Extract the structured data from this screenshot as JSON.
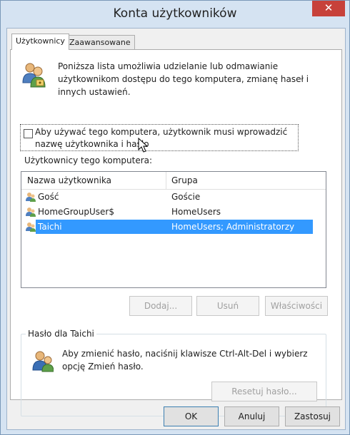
{
  "window": {
    "title": "Konta użytkowników",
    "close_glyph": "✕"
  },
  "tabs": [
    {
      "label": "Użytkownicy",
      "active": true
    },
    {
      "label": "Zaawansowane",
      "active": false
    }
  ],
  "intro": {
    "icon": "users-icon",
    "text": "Poniższa lista umożliwia udzielanie lub odmawianie użytkownikom dostępu do tego komputera, zmianę haseł i innych ustawień."
  },
  "require_password": {
    "label": "Aby używać tego komputera, użytkownik musi wprowadzić nazwę użytkownika i hasło",
    "checked": false
  },
  "users_list": {
    "heading": "Użytkownicy tego komputera:",
    "columns": {
      "name": "Nazwa użytkownika",
      "group": "Grupa"
    },
    "rows": [
      {
        "name": "Gość",
        "group": "Goście",
        "selected": false
      },
      {
        "name": "HomeGroupUser$",
        "group": "HomeUsers",
        "selected": false
      },
      {
        "name": "Taichi",
        "group": "HomeUsers; Administratorzy",
        "selected": true
      }
    ]
  },
  "list_buttons": {
    "add": "Dodaj...",
    "remove": "Usuń",
    "properties": "Właściwości"
  },
  "password_group": {
    "title": "Hasło dla Taichi",
    "text": "Aby zmienić hasło, naciśnij klawisze Ctrl-Alt-Del i wybierz opcję Zmień hasło.",
    "reset_button": "Resetuj hasło..."
  },
  "footer": {
    "ok": "OK",
    "cancel": "Anuluj",
    "apply": "Zastosuj"
  },
  "colors": {
    "selection": "#3399ff",
    "close": "#c7413a",
    "frame": "#d5e3f2"
  }
}
